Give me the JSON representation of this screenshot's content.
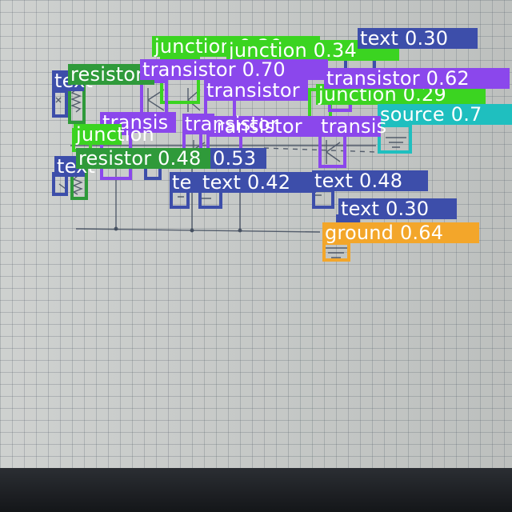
{
  "colors": {
    "text": "#3d4eaa",
    "junction": "#3bd421",
    "transistor": "#8b47ec",
    "resistor": "#2f9a3a",
    "source": "#1fbfbf",
    "ground": "#f3a62a"
  },
  "detections": [
    {
      "label": "junction 0.30",
      "cls": "junction"
    },
    {
      "label": "junction 0.34",
      "cls": "junction"
    },
    {
      "label": "text 0.30",
      "cls": "text"
    },
    {
      "label": "junction 0.29",
      "cls": "junction"
    },
    {
      "label": "text",
      "cls": "text"
    },
    {
      "label": "resistor",
      "cls": "resistor"
    },
    {
      "label": "transistor 0.70",
      "cls": "transistor"
    },
    {
      "label": "transistor 0.62",
      "cls": "transistor"
    },
    {
      "label": "transistor",
      "cls": "transistor"
    },
    {
      "label": "source 0.7",
      "cls": "source"
    },
    {
      "label": "transis",
      "cls": "transistor"
    },
    {
      "label": "transistor",
      "cls": "transistor"
    },
    {
      "label": "transis",
      "cls": "transistor"
    },
    {
      "label": "junction",
      "cls": "junction"
    },
    {
      "label": "text",
      "cls": "text"
    },
    {
      "label": "resistor 0.48",
      "cls": "resistor"
    },
    {
      "label": "0.53",
      "cls": "text"
    },
    {
      "label": "te",
      "cls": "text"
    },
    {
      "label": "text 0.42",
      "cls": "text"
    },
    {
      "label": "text 0.48",
      "cls": "text"
    },
    {
      "label": "text 0.30",
      "cls": "text"
    },
    {
      "label": "ground 0.64",
      "cls": "ground"
    },
    {
      "label": "transistor",
      "cls": "transistor"
    }
  ]
}
